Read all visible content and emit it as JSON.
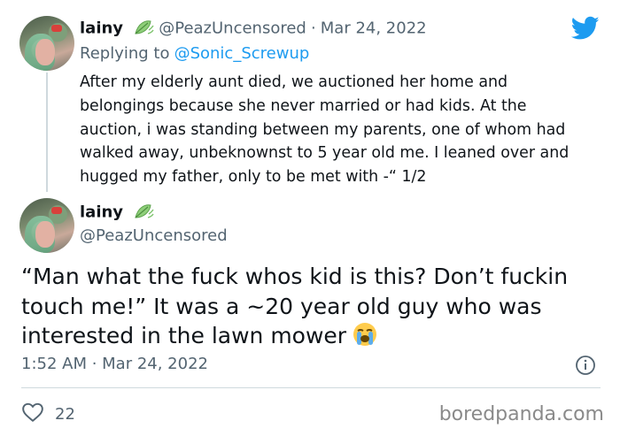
{
  "tweet1": {
    "name": "lainy",
    "handle": "@PeazUncensored",
    "separator": "·",
    "date": "Mar 24, 2022",
    "replying_prefix": "Replying to",
    "replying_to": "@Sonic_Screwup",
    "text": "After my elderly aunt died, we auctioned her home and belongings because she never married or had kids. At the auction, i was standing between my parents, one of whom had walked away, unbeknownst to 5 year old me. I leaned over and hugged my father, only to be met with -“ 1/2"
  },
  "tweet2": {
    "name": "lainy",
    "handle": "@PeazUncensored",
    "text": "“Man what the fuck whos kid is this? Don’t fuckin touch me!” It was a ~20 year old guy who was interested in the lawn mower",
    "time": "1:52 AM · Mar 24, 2022",
    "likes": "22"
  },
  "watermark": "boredpanda.com",
  "colors": {
    "accent": "#1d9bf0",
    "muted": "#536471",
    "divider": "#cfd9de",
    "leaf": "#7cc36b"
  },
  "icons": {
    "brand": "twitter-bird-icon",
    "badge": "leaf-emoji-icon",
    "emoji": "loudly-crying-face-icon",
    "info": "info-icon",
    "like": "heart-icon"
  }
}
